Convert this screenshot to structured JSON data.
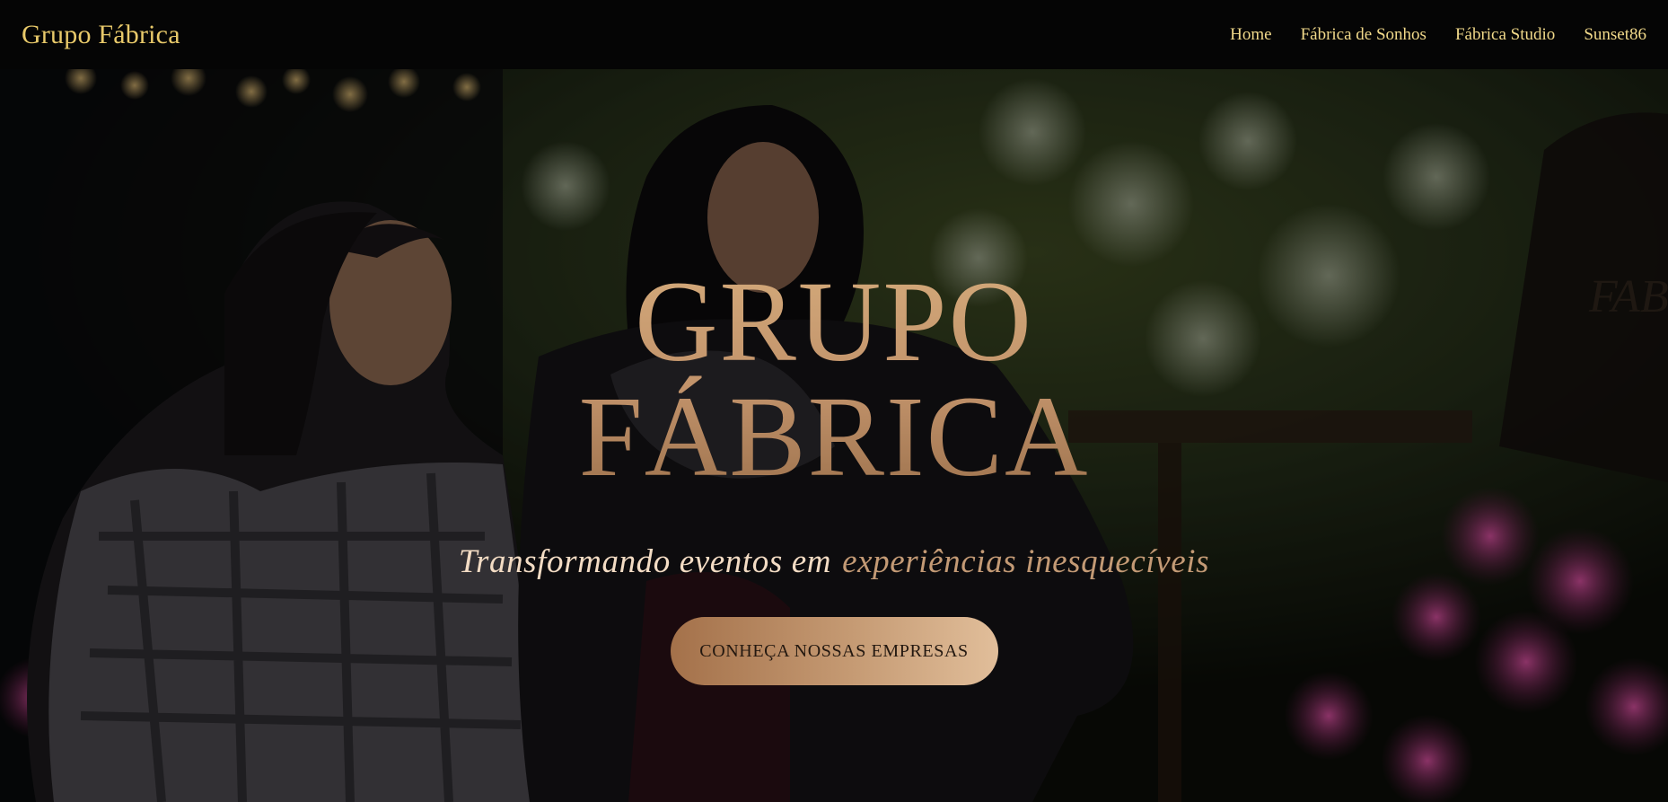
{
  "navbar": {
    "brand": "Grupo Fábrica",
    "links": [
      {
        "label": "Home"
      },
      {
        "label": "Fábrica de Sonhos"
      },
      {
        "label": "Fábrica Studio"
      },
      {
        "label": "Sunset86"
      }
    ]
  },
  "hero": {
    "title_line1": "GRUPO",
    "title_line2": "FÁBRICA",
    "subtitle_part1": "Transformando eventos em",
    "subtitle_part2": "experiências inesquecíveis",
    "cta_label": "CONHEÇA NOSSAS EMPRESAS",
    "background_image": "two women smiling at an event with floral decor",
    "background_logo_text": "FABRICA de SONHOS"
  },
  "colors": {
    "brand_gold": "#e8c96a",
    "nav_text": "#f1d98a",
    "title_bronze": "#c1926a",
    "cta_gradient_start": "#a4714a",
    "cta_gradient_end": "#e1be9a"
  }
}
